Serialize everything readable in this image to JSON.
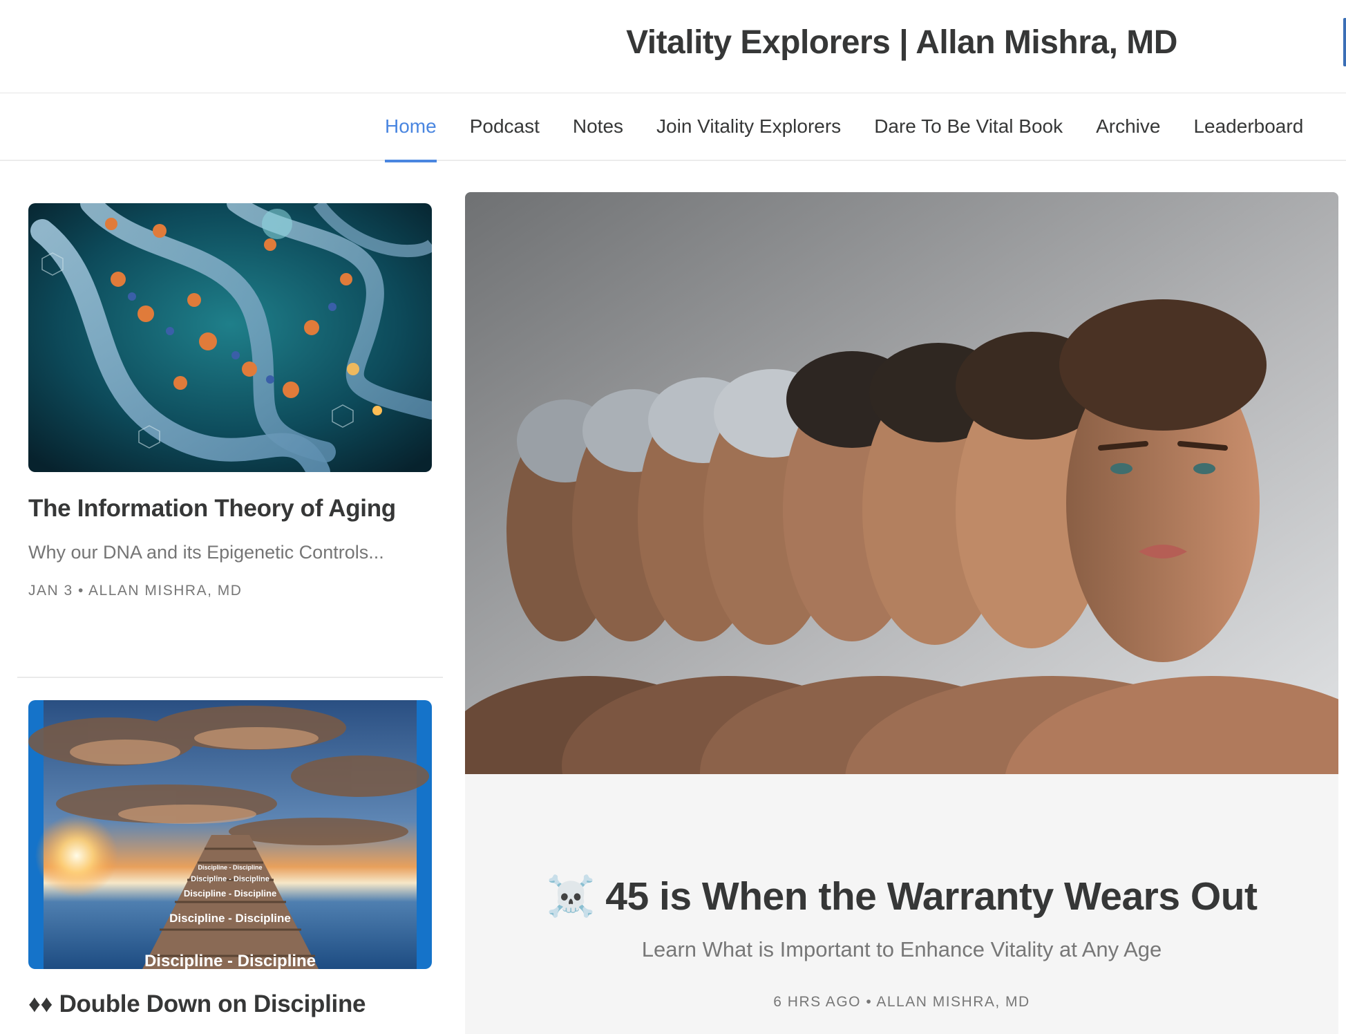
{
  "site": {
    "title": "Vitality Explorers | Allan Mishra, MD"
  },
  "nav": {
    "items": [
      {
        "label": "Home",
        "active": true
      },
      {
        "label": "Podcast"
      },
      {
        "label": "Notes"
      },
      {
        "label": "Join Vitality Explorers"
      },
      {
        "label": "Dare To Be Vital Book"
      },
      {
        "label": "Archive"
      },
      {
        "label": "Leaderboard"
      }
    ]
  },
  "posts": [
    {
      "title": "The Information Theory of Aging",
      "subtitle": "Why our DNA and its Epigenetic Controls...",
      "meta": "JAN 3 • ALLAN MISHRA, MD",
      "image": "dna-helix-illustration"
    },
    {
      "title_prefix": "♦♦",
      "title": "Double Down on Discipline",
      "image": "discipline-stairway-sunset",
      "image_texts": [
        "Discipline - Discipline",
        "Discipline - Discipline",
        "Discipline - Discipline",
        "Discipline - Discipline",
        "Discipline - Discipline"
      ]
    }
  ],
  "featured": {
    "icon": "skull-crossbones-icon",
    "icon_glyph": "☠️",
    "title": "45 is When the Warranty Wears Out",
    "subtitle": "Learn What is Important to Enhance Vitality at Any Age",
    "meta": "6 HRS AGO • ALLAN MISHRA, MD",
    "image": "aging-faces-sequence"
  },
  "colors": {
    "accent": "#4a86e0",
    "text": "#363737",
    "muted": "#777777"
  }
}
